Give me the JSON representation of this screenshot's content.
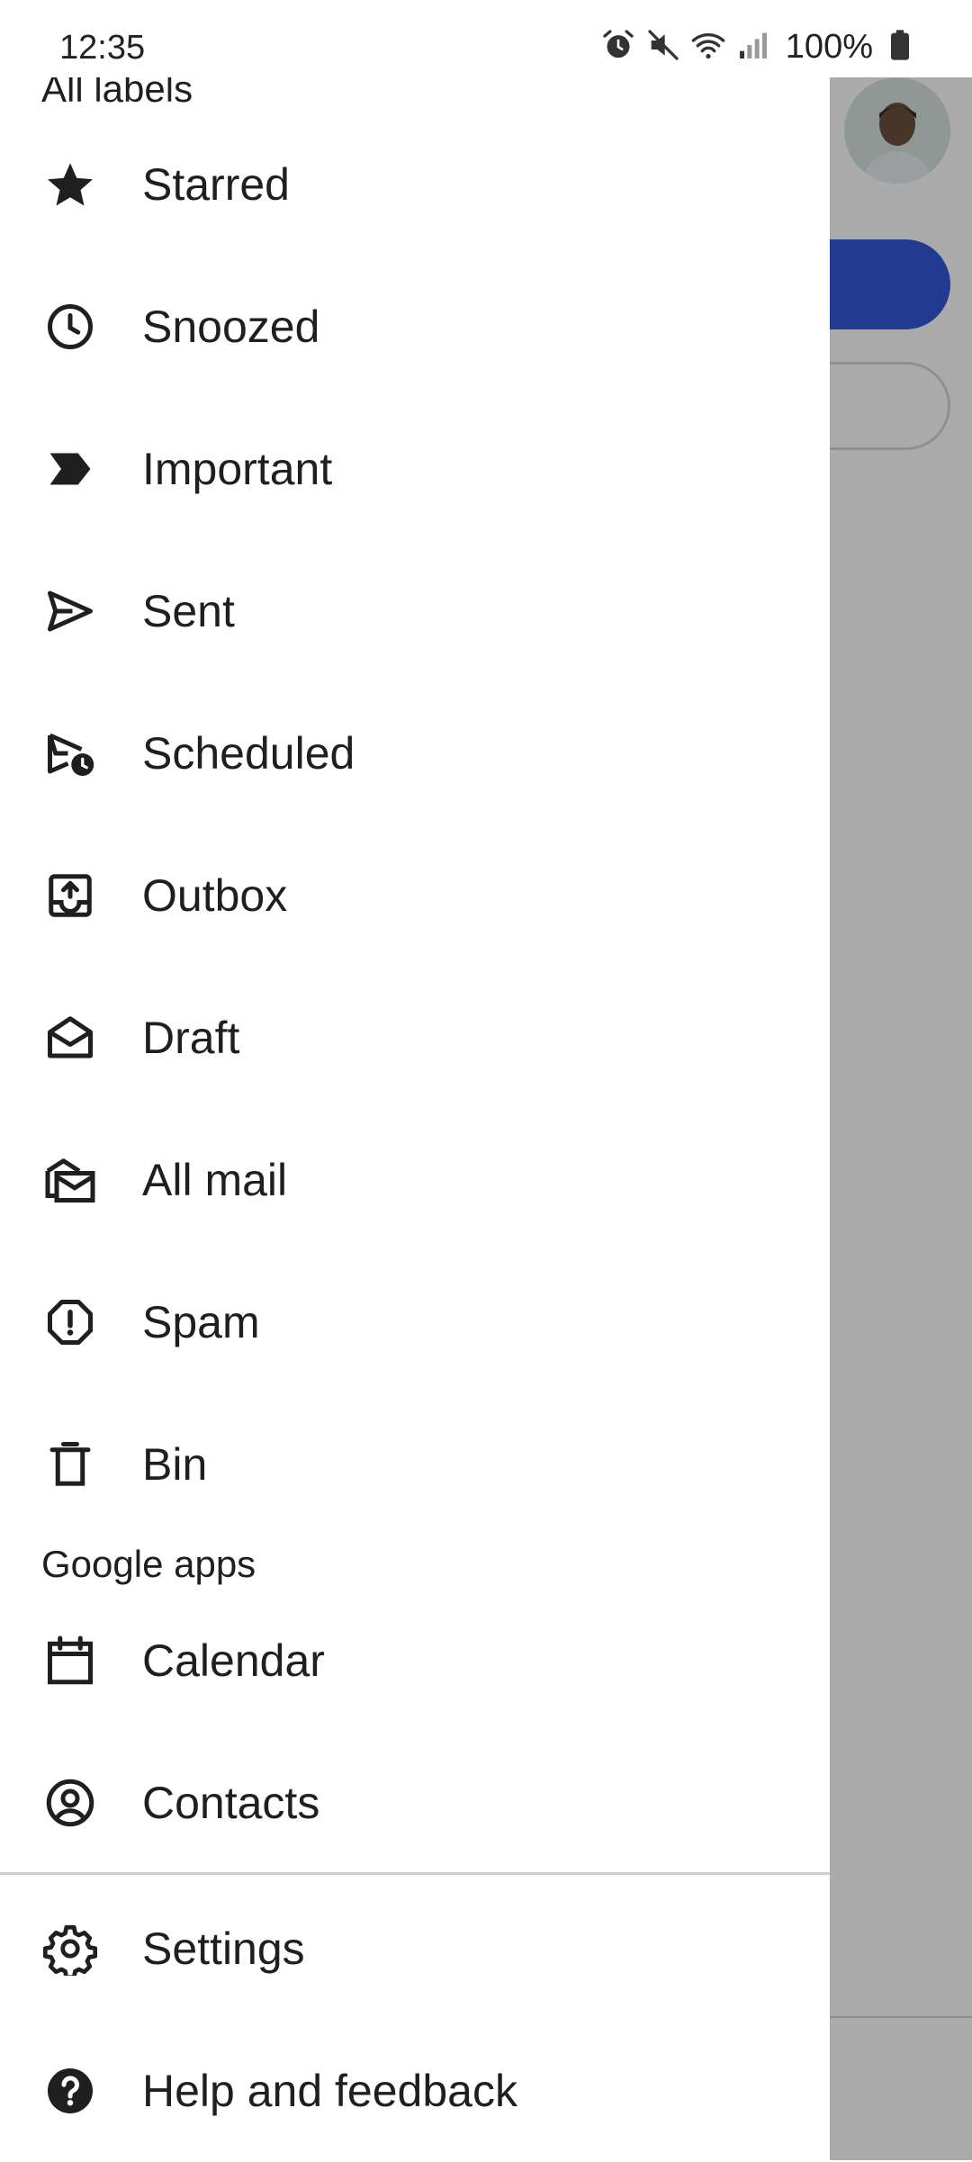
{
  "status_bar": {
    "time": "12:35",
    "battery": "100%",
    "icons": [
      "alarm-icon",
      "mute-icon",
      "wifi-icon",
      "signal-icon",
      "battery-icon"
    ]
  },
  "drawer": {
    "labels_header": "All labels",
    "items": [
      {
        "label": "Starred",
        "icon": "star-icon"
      },
      {
        "label": "Snoozed",
        "icon": "clock-icon"
      },
      {
        "label": "Important",
        "icon": "important-icon"
      },
      {
        "label": "Sent",
        "icon": "send-icon"
      },
      {
        "label": "Scheduled",
        "icon": "scheduled-send-icon"
      },
      {
        "label": "Outbox",
        "icon": "outbox-icon"
      },
      {
        "label": "Draft",
        "icon": "draft-icon"
      },
      {
        "label": "All mail",
        "icon": "all-mail-icon"
      },
      {
        "label": "Spam",
        "icon": "spam-icon"
      },
      {
        "label": "Bin",
        "icon": "bin-icon"
      }
    ],
    "apps_header": "Google apps",
    "apps": [
      {
        "label": "Calendar",
        "icon": "calendar-icon"
      },
      {
        "label": "Contacts",
        "icon": "contacts-icon"
      }
    ],
    "footer": [
      {
        "label": "Settings",
        "icon": "gear-icon"
      },
      {
        "label": "Help and feedback",
        "icon": "help-icon"
      }
    ]
  },
  "colors": {
    "accent": "#3459d8",
    "text": "#1f1f1f",
    "scrim": "rgba(0,0,0,0.33)"
  }
}
